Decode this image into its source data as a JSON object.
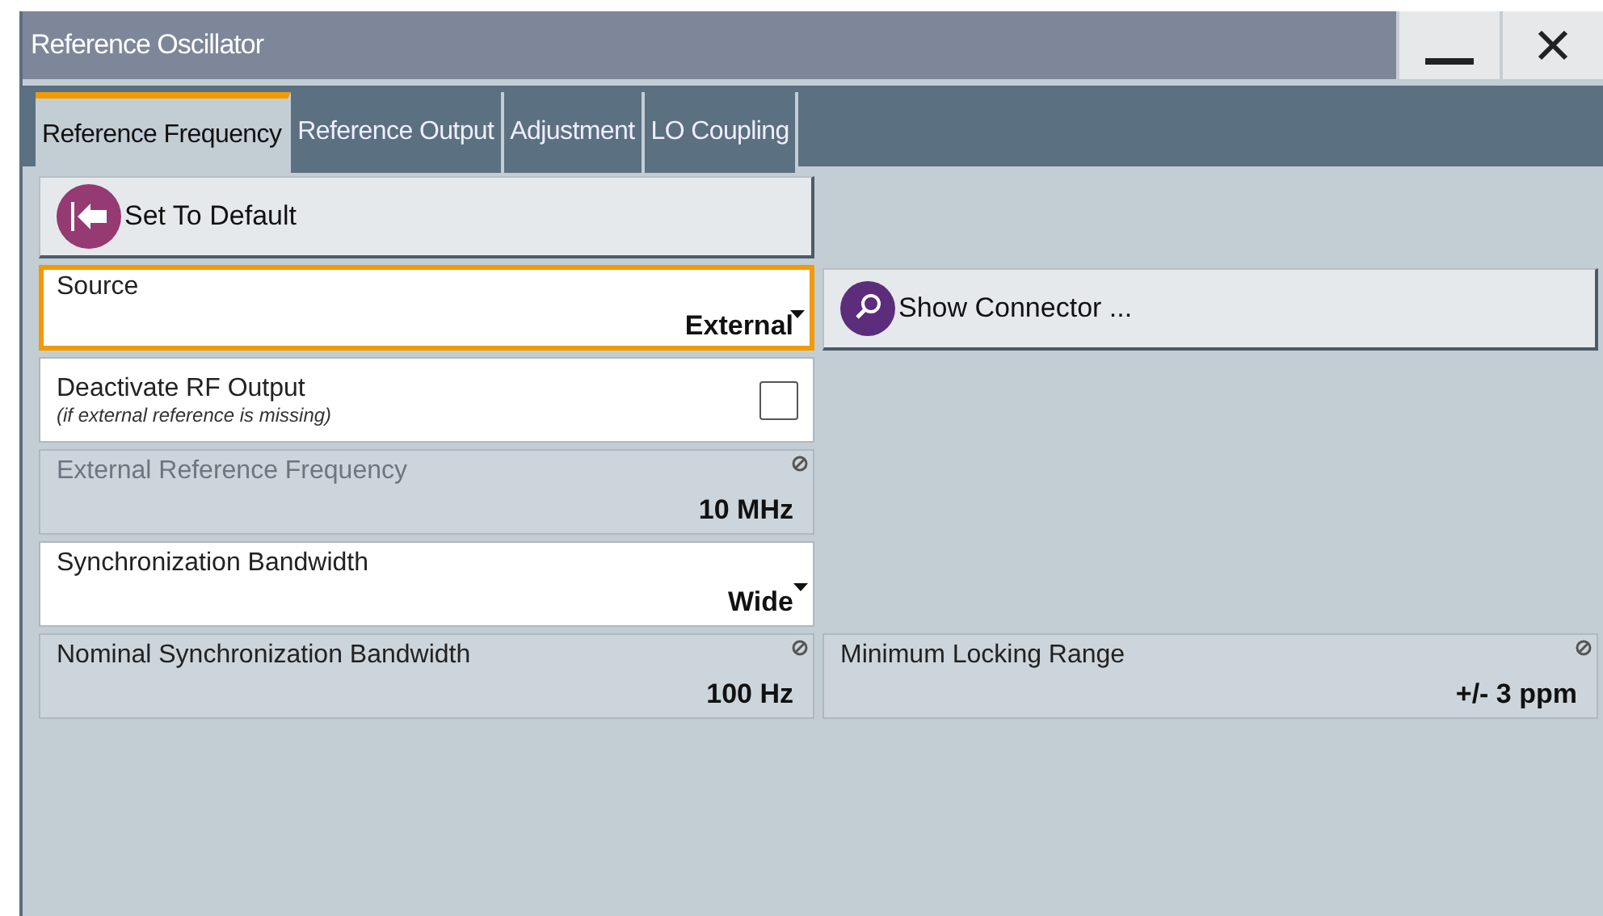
{
  "window": {
    "title": "Reference Oscillator"
  },
  "tabs": [
    {
      "label": "Reference Frequency",
      "selected": true
    },
    {
      "label": "Reference Output",
      "selected": false
    },
    {
      "label": "Adjustment",
      "selected": false
    },
    {
      "label": "LO Coupling",
      "selected": false
    }
  ],
  "rows": [
    {
      "cells": [
        {
          "kind": "reset",
          "label": "Set To Default"
        }
      ]
    },
    {
      "cells": [
        {
          "kind": "select",
          "label": "Source",
          "value": "External",
          "focused": true
        },
        {
          "kind": "connector",
          "label": "Show Connector ..."
        }
      ]
    },
    {
      "cells": [
        {
          "kind": "checkbox",
          "label": "Deactivate RF Output",
          "hint": "(if external reference is missing)",
          "checked": false
        }
      ]
    },
    {
      "cells": [
        {
          "kind": "readonly",
          "label": "External Reference Frequency",
          "value": "10 MHz",
          "disabled": true
        }
      ]
    },
    {
      "cells": [
        {
          "kind": "select",
          "label": "Synchronization Bandwidth",
          "value": "Wide",
          "focused": false
        }
      ]
    },
    {
      "cells": [
        {
          "kind": "readonly",
          "label": "Nominal Synchronization Bandwidth",
          "value": "100 Hz",
          "disabled": false
        },
        {
          "kind": "readonly",
          "label": "Minimum Locking Range",
          "value": "+/- 3 ppm",
          "disabled": false
        }
      ]
    }
  ]
}
